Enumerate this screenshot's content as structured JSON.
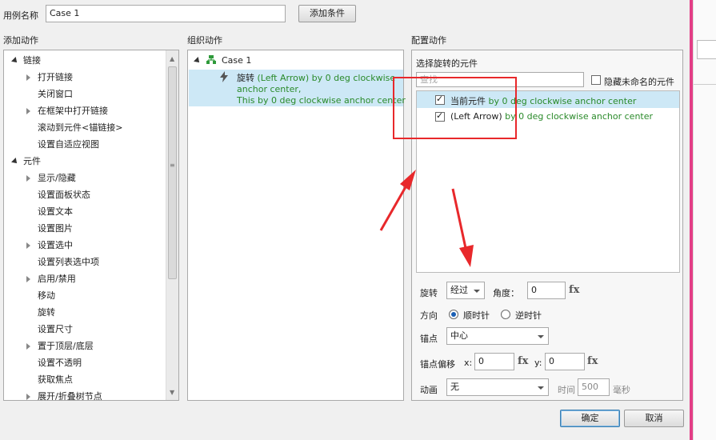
{
  "header": {
    "case_name_label": "用例名称",
    "case_name_value": "Case 1",
    "add_condition_button": "添加条件"
  },
  "add_actions": {
    "title": "添加动作",
    "items": [
      {
        "label": "链接",
        "level": 0,
        "expand": "open"
      },
      {
        "label": "打开链接",
        "level": 1,
        "expand": "closed"
      },
      {
        "label": "关闭窗口",
        "level": 1,
        "expand": "none"
      },
      {
        "label": "在框架中打开链接",
        "level": 1,
        "expand": "closed"
      },
      {
        "label": "滚动到元件<锚链接>",
        "level": 1,
        "expand": "none"
      },
      {
        "label": "设置自适应视图",
        "level": 1,
        "expand": "none"
      },
      {
        "label": "元件",
        "level": 0,
        "expand": "open"
      },
      {
        "label": "显示/隐藏",
        "level": 1,
        "expand": "closed"
      },
      {
        "label": "设置面板状态",
        "level": 1,
        "expand": "none"
      },
      {
        "label": "设置文本",
        "level": 1,
        "expand": "none"
      },
      {
        "label": "设置图片",
        "level": 1,
        "expand": "none"
      },
      {
        "label": "设置选中",
        "level": 1,
        "expand": "closed"
      },
      {
        "label": "设置列表选中项",
        "level": 1,
        "expand": "none"
      },
      {
        "label": "启用/禁用",
        "level": 1,
        "expand": "closed"
      },
      {
        "label": "移动",
        "level": 1,
        "expand": "none"
      },
      {
        "label": "旋转",
        "level": 1,
        "expand": "none"
      },
      {
        "label": "设置尺寸",
        "level": 1,
        "expand": "none"
      },
      {
        "label": "置于顶层/底层",
        "level": 1,
        "expand": "closed"
      },
      {
        "label": "设置不透明",
        "level": 1,
        "expand": "none"
      },
      {
        "label": "获取焦点",
        "level": 1,
        "expand": "none"
      },
      {
        "label": "展开/折叠树节点",
        "level": 1,
        "expand": "closed"
      }
    ]
  },
  "organize_actions": {
    "title": "组织动作",
    "case_label": "Case 1",
    "action_prefix": "旋转",
    "action_line1_rest": " (Left Arrow) by 0 deg clockwise",
    "action_line2": "anchor center,",
    "action_line3": "This by 0 deg clockwise anchor center"
  },
  "config": {
    "title": "配置动作",
    "select_label": "选择旋转的元件",
    "search_placeholder": "查找",
    "hide_unnamed_label": "隐藏未命名的元件",
    "widgets": [
      {
        "name": "当前元件",
        "detail": " by 0 deg clockwise anchor center",
        "checked": true
      },
      {
        "name": "(Left Arrow)",
        "detail": " by 0 deg clockwise anchor center",
        "checked": true
      }
    ],
    "rotate_label": "旋转",
    "rotate_mode": "经过",
    "angle_label": "角度：",
    "angle_value": "0",
    "fx": "fx",
    "direction_label": "方向",
    "clockwise_label": "顺时针",
    "counterclockwise_label": "逆时针",
    "anchor_label": "锚点",
    "anchor_value": "中心",
    "anchor_offset_label": "锚点偏移",
    "x_label": "x:",
    "x_value": "0",
    "y_label": "y:",
    "y_value": "0",
    "animation_label": "动画",
    "animation_value": "无",
    "time_label": "时间",
    "time_value": "500",
    "time_unit": "毫秒"
  },
  "footer": {
    "ok_button": "确定",
    "cancel_button": "取消"
  },
  "colors": {
    "highlight": "#cde8f6",
    "annotation_red": "#e8282b",
    "detail_green": "#2a8a2a"
  }
}
